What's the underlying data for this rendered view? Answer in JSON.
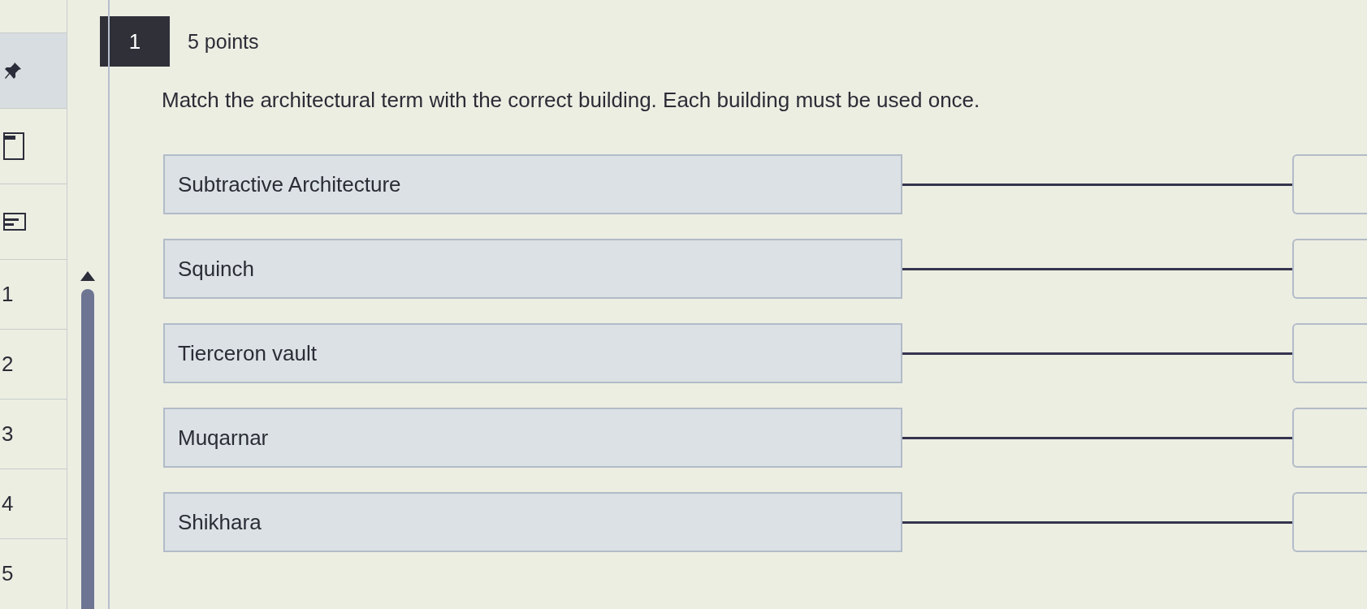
{
  "question": {
    "number": "1",
    "points": "5 points",
    "prompt": "Match the architectural term with the correct building. Each building must be used once."
  },
  "navigator": {
    "items": [
      {
        "label": "1"
      },
      {
        "label": "2"
      },
      {
        "label": "3"
      },
      {
        "label": "4"
      },
      {
        "label": "5"
      }
    ]
  },
  "matches": [
    {
      "term": "Subtractive Architecture"
    },
    {
      "term": "Squinch"
    },
    {
      "term": "Tierceron vault"
    },
    {
      "term": "Muqarnar"
    },
    {
      "term": "Shikhara"
    }
  ]
}
